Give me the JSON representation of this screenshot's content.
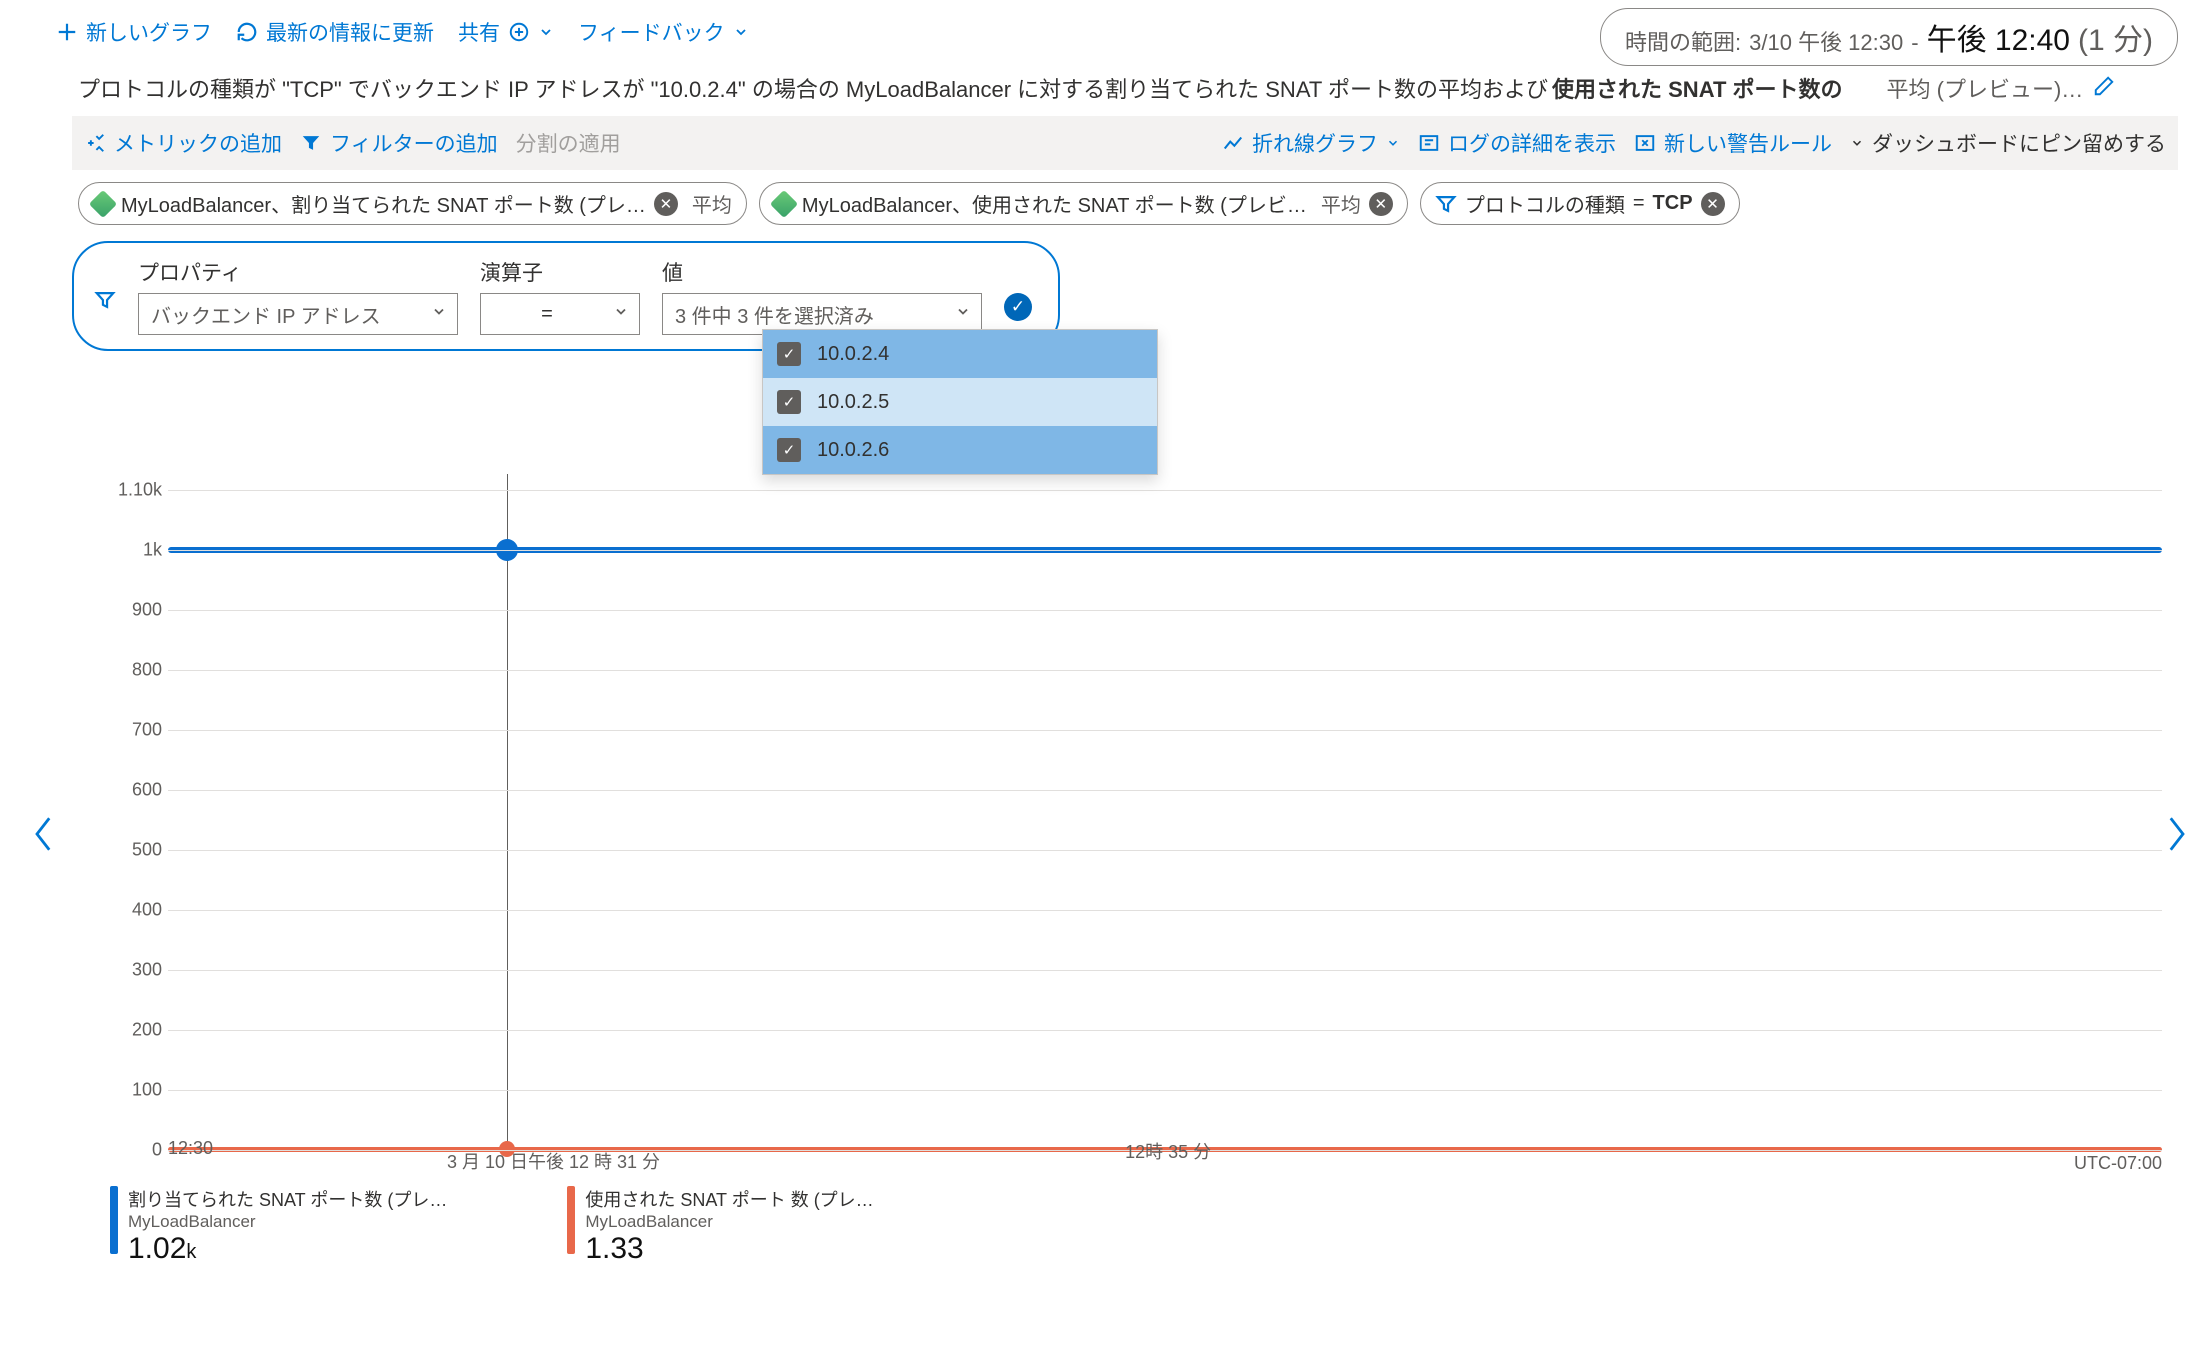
{
  "toolbar": {
    "new_chart": "新しいグラフ",
    "refresh": "最新の情報に更新",
    "share": "共有",
    "feedback": "フィードバック"
  },
  "time_picker": {
    "prefix": "時間の範囲:",
    "start": "3/10 午後 12:30",
    "sep": "-",
    "end": "午後 12:40",
    "duration": "(1 分)"
  },
  "title": {
    "main": "プロトコルの種類が \"TCP\" でバックエンド IP アドレスが \"10.0.2.4\" の場合の MyLoadBalancer に対する割り当てられた SNAT ポート数の平均および",
    "bold": "使用された SNAT ポート数の",
    "agg": "平均 (プレビュー)…"
  },
  "toolbar2": {
    "add_metric": "メトリックの追加",
    "add_filter": "フィルターの追加",
    "apply_split": "分割の適用",
    "chart_type": "折れ線グラフ",
    "drill_logs": "ログの詳細を表示",
    "new_alert": "新しい警告ルール",
    "pin": "ダッシュボードにピン留めする"
  },
  "chips": {
    "m1_label": "MyLoadBalancer、割り当てられた SNAT ポート数 (プレ…",
    "m1_agg": "平均",
    "m2_label": "MyLoadBalancer、使用された SNAT ポート数 (プレビ…",
    "m2_agg": "平均",
    "f1_prop": "プロトコルの種類",
    "f1_op": "=",
    "f1_val": "TCP"
  },
  "filter_panel": {
    "prop_label": "プロパティ",
    "op_label": "演算子",
    "val_label": "値",
    "prop_value": "バックエンド IP アドレス",
    "op_value": "=",
    "val_value": "3 件中 3 件を選択済み",
    "options": [
      "10.0.2.4",
      "10.0.2.5",
      "10.0.2.6"
    ]
  },
  "chart_data": {
    "type": "line",
    "x_start_label": "12:30",
    "x_mid_label": "12時 35 分",
    "cursor_label": "3 月 10 日午後 12 時 31 分",
    "tz": "UTC-07:00",
    "y_ticks": [
      "0",
      "100",
      "200",
      "300",
      "400",
      "500",
      "600",
      "700",
      "800",
      "900",
      "1k",
      "1.10k"
    ],
    "ylim": [
      0,
      1100
    ],
    "series": [
      {
        "name": "割り当てられた SNAT ポート数 (プレ…",
        "resource": "MyLoadBalancer",
        "color": "#0a6fd0",
        "value_at_cursor": "1.02",
        "unit": "k",
        "flat_value": 1000
      },
      {
        "name": "使用された SNAT ポート 数 (プレ…",
        "resource": "MyLoadBalancer",
        "color": "#e8684a",
        "value_at_cursor": "1.33",
        "unit": "",
        "flat_value": 1
      }
    ],
    "cursor_fraction": 0.17
  }
}
